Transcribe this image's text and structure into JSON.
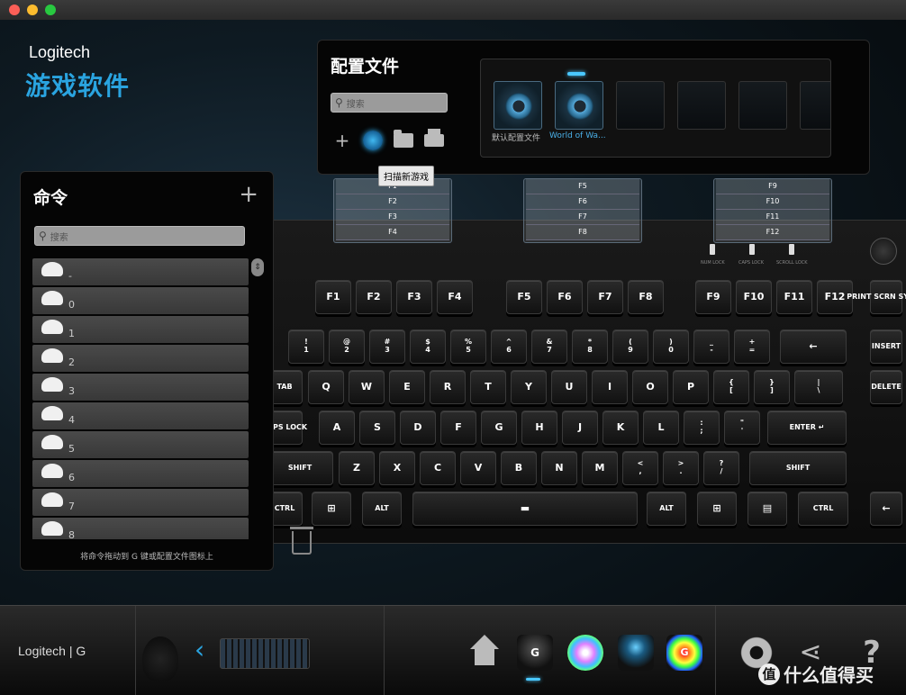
{
  "window": {
    "brand_en": "Logitech",
    "brand_cn": "游戏软件"
  },
  "profiles": {
    "title": "配置文件",
    "search_placeholder": "搜索",
    "tooltip": "扫描新游戏",
    "slots": [
      {
        "label": "默认配置文件",
        "active": false
      },
      {
        "label": "World of Wa...",
        "active": true
      }
    ]
  },
  "fkey_groups": [
    [
      "F1",
      "F2",
      "F3",
      "F4"
    ],
    [
      "F5",
      "F6",
      "F7",
      "F8"
    ],
    [
      "F9",
      "F10",
      "F11",
      "F12"
    ]
  ],
  "commands": {
    "title": "命令",
    "search_placeholder": "搜索",
    "items": [
      "-",
      "0",
      "1",
      "2",
      "3",
      "4",
      "5",
      "6",
      "7",
      "8"
    ],
    "footer": "将命令拖动到 G 键或配置文件图标上"
  },
  "keyboard": {
    "function_row": [
      "F1",
      "F2",
      "F3",
      "F4",
      "F5",
      "F6",
      "F7",
      "F8",
      "F9",
      "F10",
      "F11",
      "F12"
    ],
    "print_screen": "PRINT SCRN SYSRQ",
    "locks": [
      "NUM LOCK",
      "CAPS LOCK",
      "SCROLL LOCK"
    ],
    "number_row": [
      "!\n1",
      "@\n2",
      "#\n3",
      "$\n4",
      "%\n5",
      "^\n6",
      "&\n7",
      "*\n8",
      "(\n9",
      ")\n0",
      "_\n-",
      "+\n="
    ],
    "backspace": "←",
    "insert": "INSERT",
    "tab": "TAB",
    "qwerty_row": [
      "Q",
      "W",
      "E",
      "R",
      "T",
      "Y",
      "U",
      "I",
      "O",
      "P",
      "{\n[",
      "}\n]",
      "|\n\\"
    ],
    "delete": "DELETE",
    "caps": "CAPS LOCK",
    "home_row": [
      "A",
      "S",
      "D",
      "F",
      "G",
      "H",
      "J",
      "K",
      "L",
      ":\n;",
      "\"\n'"
    ],
    "enter": "ENTER ↵",
    "shift_left": "SHIFT",
    "bottom_letters": [
      "Z",
      "X",
      "C",
      "V",
      "B",
      "N",
      "M",
      "<\n,",
      ">\n.",
      "?\n/"
    ],
    "shift_right": "SHIFT",
    "ctrl_left": "CTRL",
    "win_left": "⊞",
    "alt_left": "ALT",
    "space": "▬",
    "alt_right": "ALT",
    "win_right": "⊞",
    "menu": "▤",
    "ctrl_right": "CTRL",
    "arrow_left": "←"
  },
  "bottombar": {
    "logo": "Logitech | G",
    "nav_prev": "‹",
    "gkey_label": "G",
    "heat_label": "G"
  },
  "watermark": {
    "mark": "值",
    "text": "什么值得买"
  },
  "colors": {
    "accent": "#2aa4e0",
    "panel": "#050505"
  }
}
